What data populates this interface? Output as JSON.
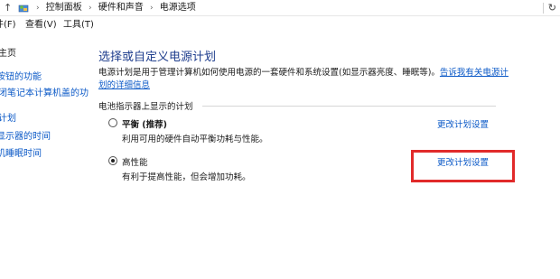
{
  "address_bar": {
    "up_icon": "up-arrow-icon",
    "folder_icon": "control-panel-icon",
    "breadcrumbs": [
      "控制面板",
      "硬件和声音",
      "电源选项"
    ],
    "refresh_icon": "refresh-icon"
  },
  "menu": {
    "file": "件(F)",
    "edit": "编辑(E)",
    "view": "查看(V)",
    "tools": "工具(T)"
  },
  "left_nav": {
    "home": "主页",
    "items": [
      "按钮的功能",
      "择关闭笔记本计算机盖的功",
      "计划",
      "显示器的时间",
      "机睡眠时间"
    ]
  },
  "main": {
    "title": "选择或自定义电源计划",
    "description": "电源计划是用于管理计算机如何使用电源的一套硬件和系统设置(如显示器亮度、睡眠等)。",
    "description_link": "告诉我有关电源计划的详细信息",
    "section_label": "电池指示器上显示的计划",
    "plans": [
      {
        "name": "平衡 (推荐)",
        "desc": "利用可用的硬件自动平衡功耗与性能。",
        "link": "更改计划设置",
        "selected": false
      },
      {
        "name": "高性能",
        "desc": "有利于提高性能，但会增加功耗。",
        "link": "更改计划设置",
        "selected": true
      }
    ]
  },
  "highlight_color": "#e12a2a",
  "link_color": "#0b59c7",
  "title_color": "#1d3c8c"
}
